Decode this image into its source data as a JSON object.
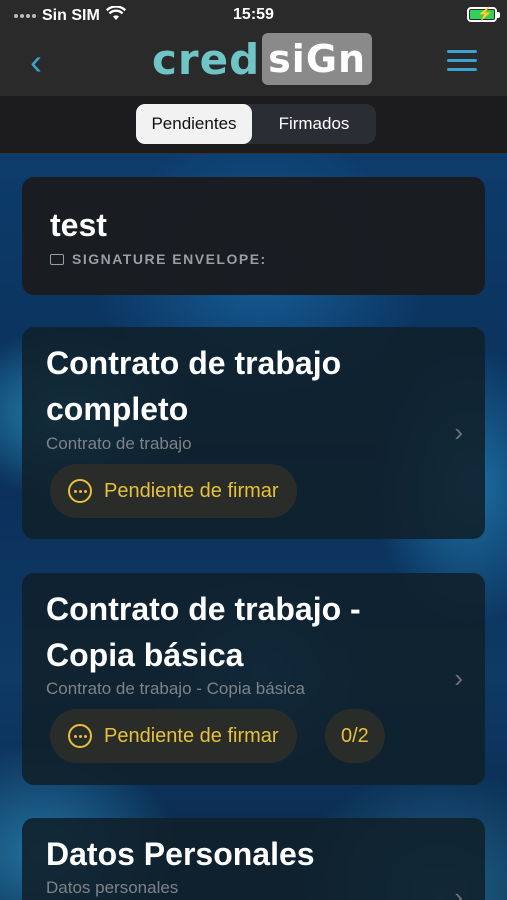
{
  "status": {
    "carrier": "Sin SIM",
    "time": "15:59",
    "icons": [
      "signal-icon",
      "wifi-icon",
      "battery-charging-icon"
    ]
  },
  "nav": {
    "logo_left": "cred",
    "logo_right": "siGn",
    "back_icon": "chevron-left-icon",
    "menu_icon": "hamburger-icon"
  },
  "tabs": [
    {
      "label": "Pendientes",
      "active": true
    },
    {
      "label": "Firmados",
      "active": false
    }
  ],
  "envelope": {
    "title": "test",
    "label": "SIGNATURE ENVELOPE:"
  },
  "documents": [
    {
      "title_line1": "Contrato de trabajo",
      "title_line2": "completo",
      "subtitle": "Contrato de trabajo",
      "status": "Pendiente de firmar"
    },
    {
      "title_line1": "Contrato de trabajo -",
      "title_line2": "Copia básica",
      "subtitle": "Contrato de trabajo - Copia básica",
      "status": "Pendiente de firmar",
      "count": "0/2"
    },
    {
      "title_line1": "Datos Personales",
      "subtitle": "Datos personales"
    }
  ],
  "colors": {
    "accent": "#3aa3cf",
    "status_pending": "#e7c13a",
    "logo_teal": "#6fc5c5"
  }
}
